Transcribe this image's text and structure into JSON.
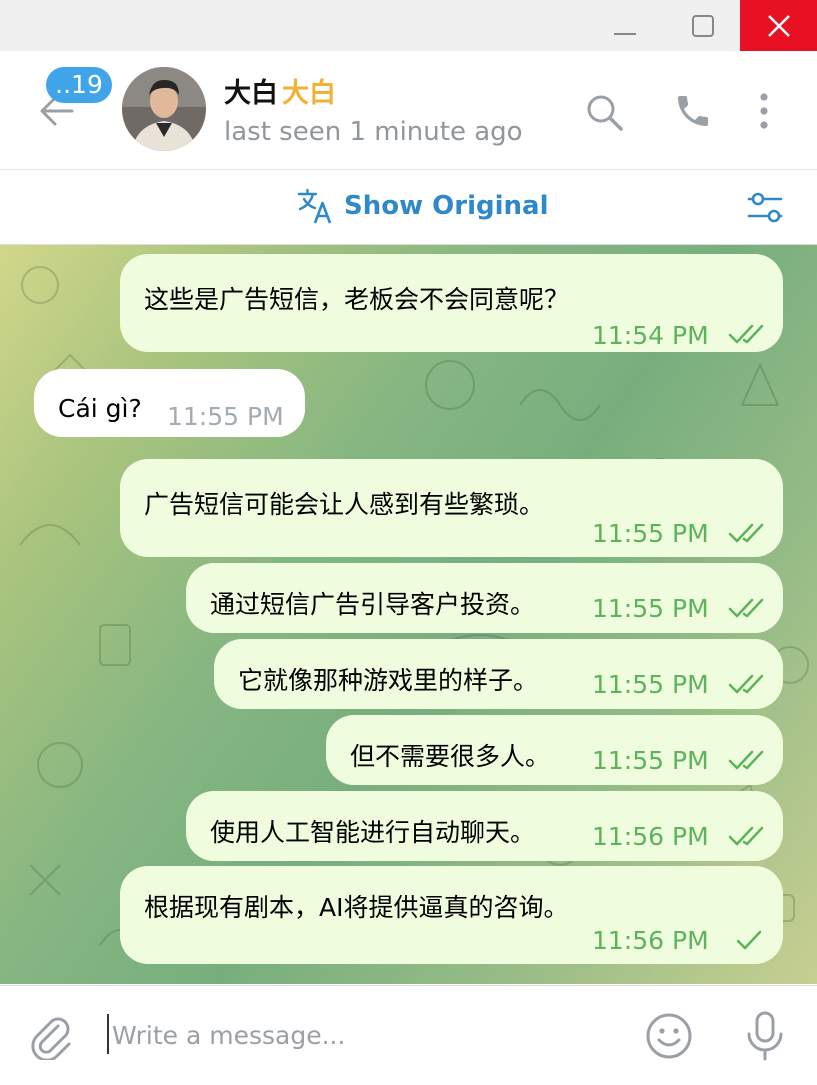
{
  "window": {
    "minimize": "minimize-icon",
    "maximize": "maximize-icon",
    "close": "close-icon",
    "close_color": "#e81123"
  },
  "header": {
    "back_icon": "arrow-left-icon",
    "unread_badge": "..19",
    "contact_name": "大白",
    "contact_name_highlight": "大白",
    "status": "last seen 1 minute ago",
    "icons": [
      "search-icon",
      "phone-icon",
      "more-vert-icon"
    ]
  },
  "translate_bar": {
    "label": "Show Original",
    "icon": "translate-icon",
    "settings_icon": "sliders-icon",
    "accent": "#2f89c9"
  },
  "messages": [
    {
      "direction": "out",
      "text": "这些是广告短信，老板会不会同意呢？",
      "time": "11:54 PM",
      "status": "read"
    },
    {
      "direction": "in",
      "text": "Cái gì?",
      "time": "11:55 PM"
    },
    {
      "direction": "out",
      "text": "广告短信可能会让人感到有些繁琐。",
      "time": "11:55 PM",
      "status": "read"
    },
    {
      "direction": "out",
      "text": "通过短信广告引导客户投资。",
      "time": "11:55 PM",
      "status": "read"
    },
    {
      "direction": "out",
      "text": "它就像那种游戏里的样子。",
      "time": "11:55 PM",
      "status": "read"
    },
    {
      "direction": "out",
      "text": "但不需要很多人。",
      "time": "11:55 PM",
      "status": "read"
    },
    {
      "direction": "out",
      "text": "使用人工智能进行自动聊天。",
      "time": "11:56 PM",
      "status": "read"
    },
    {
      "direction": "out",
      "text": "根据现有剧本，AI将提供逼真的咨询。",
      "time": "11:56 PM",
      "status": "sent"
    }
  ],
  "composer": {
    "placeholder": "Write a message...",
    "value": "",
    "attach_icon": "paperclip-icon",
    "emoji_icon": "smile-icon",
    "mic_icon": "microphone-icon"
  },
  "colors": {
    "outgoing_bubble": "#effdde",
    "incoming_bubble": "#ffffff",
    "time_out": "#5cb45a",
    "time_in": "#a3abb3"
  }
}
